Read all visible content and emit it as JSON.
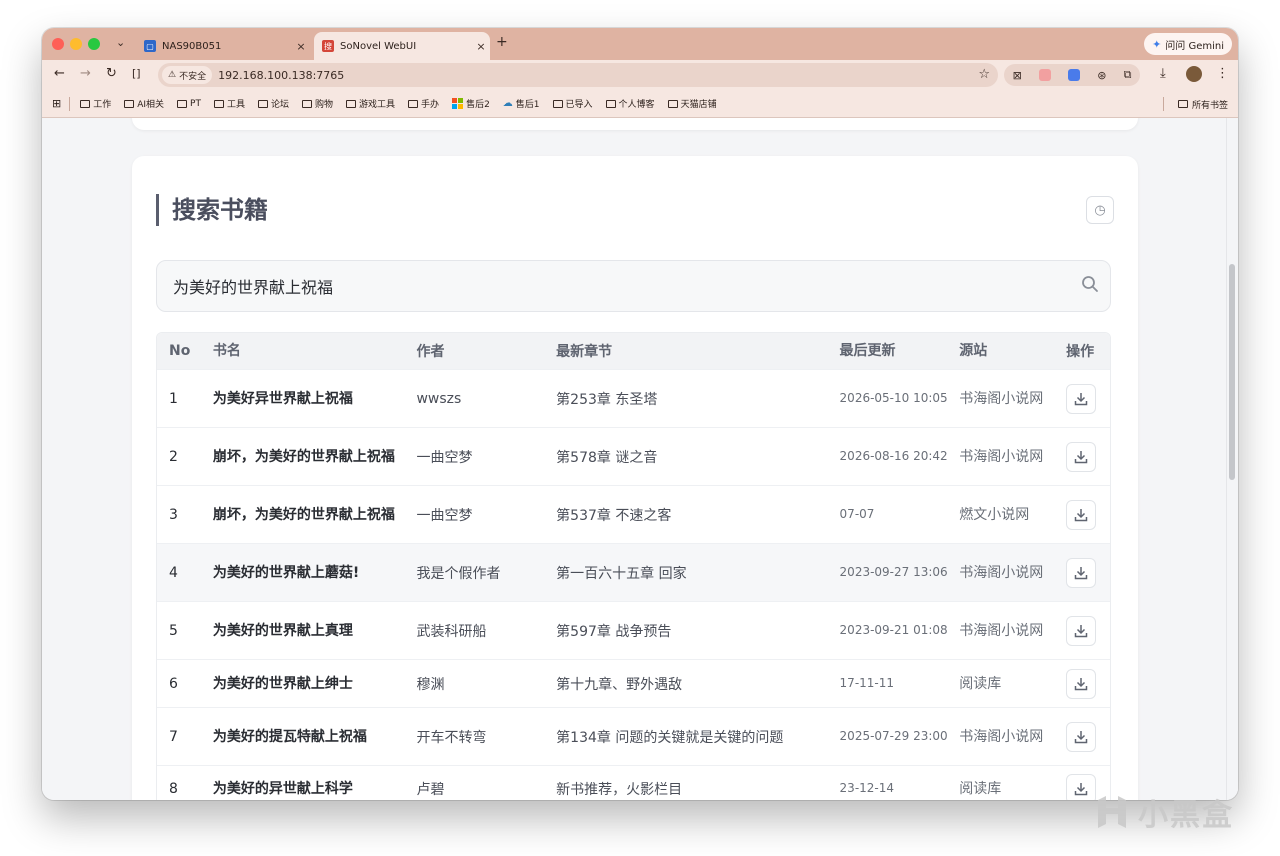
{
  "browser": {
    "tabs": [
      {
        "title": "NAS90B051",
        "close": "×"
      },
      {
        "title": "SoNovel WebUI",
        "close": "×",
        "favicon_text": "搜"
      }
    ],
    "new_tab": "+",
    "gemini_label": "问问 Gemini",
    "insecure_label": "不安全",
    "url": "192.168.100.138:7765",
    "bookmarks": [
      {
        "label": "工作",
        "icon": "folder-icon"
      },
      {
        "label": "AI相关",
        "icon": "folder-icon"
      },
      {
        "label": "PT",
        "icon": "folder-icon"
      },
      {
        "label": "工具",
        "icon": "folder-icon"
      },
      {
        "label": "论坛",
        "icon": "folder-icon"
      },
      {
        "label": "购物",
        "icon": "folder-icon"
      },
      {
        "label": "游戏工具",
        "icon": "folder-icon"
      },
      {
        "label": "手办",
        "icon": "folder-icon"
      },
      {
        "label": "售后2",
        "icon": "windows-logo-icon"
      },
      {
        "label": "售后1",
        "icon": "cloud-icon"
      },
      {
        "label": "已导入",
        "icon": "folder-icon"
      },
      {
        "label": "个人博客",
        "icon": "folder-icon"
      },
      {
        "label": "天猫店铺",
        "icon": "folder-icon"
      }
    ],
    "all_bookmarks": "所有书签"
  },
  "page": {
    "section_title": "搜索书籍",
    "search_value": "为美好的世界献上祝福",
    "columns": [
      "No",
      "书名",
      "作者",
      "最新章节",
      "最后更新",
      "源站",
      "操作"
    ],
    "rows": [
      {
        "no": "1",
        "title": "为美好异世界献上祝福",
        "author": "wwszs",
        "chapter": "第253章 东圣塔",
        "date": "2026-05-10 10:05",
        "source": "书海阁小说网"
      },
      {
        "no": "2",
        "title": "崩坏，为美好的世界献上祝福",
        "author": "一曲空梦",
        "chapter": "第578章 谜之音",
        "date": "2026-08-16 20:42",
        "source": "书海阁小说网"
      },
      {
        "no": "3",
        "title": "崩坏，为美好的世界献上祝福",
        "author": "一曲空梦",
        "chapter": "第537章 不速之客",
        "date": "07-07",
        "source": "燃文小说网"
      },
      {
        "no": "4",
        "title": "为美好的世界献上蘑菇!",
        "author": "我是个假作者",
        "chapter": "第一百六十五章 回家",
        "date": "2023-09-27 13:06",
        "source": "书海阁小说网"
      },
      {
        "no": "5",
        "title": "为美好的世界献上真理",
        "author": "武装科研船",
        "chapter": "第597章 战争预告",
        "date": "2023-09-21 01:08",
        "source": "书海阁小说网"
      },
      {
        "no": "6",
        "title": "为美好的世界献上绅士",
        "author": "穆渊",
        "chapter": "第十九章、野外遇敌",
        "date": "17-11-11",
        "source": "阅读库"
      },
      {
        "no": "7",
        "title": "为美好的提瓦特献上祝福",
        "author": "开车不转弯",
        "chapter": "第134章 问题的关键就是关键的问题",
        "date": "2025-07-29 23:00",
        "source": "书海阁小说网"
      },
      {
        "no": "8",
        "title": "为美好的异世献上科学",
        "author": "卢碧",
        "chapter": "新书推荐，火影栏目",
        "date": "23-12-14",
        "source": "阅读库"
      }
    ]
  },
  "watermark": "小黑盒",
  "colors": {
    "tabstrip": "#dfb3a2",
    "toolbar": "#f6e7e1",
    "title": "#4a4e5e"
  }
}
